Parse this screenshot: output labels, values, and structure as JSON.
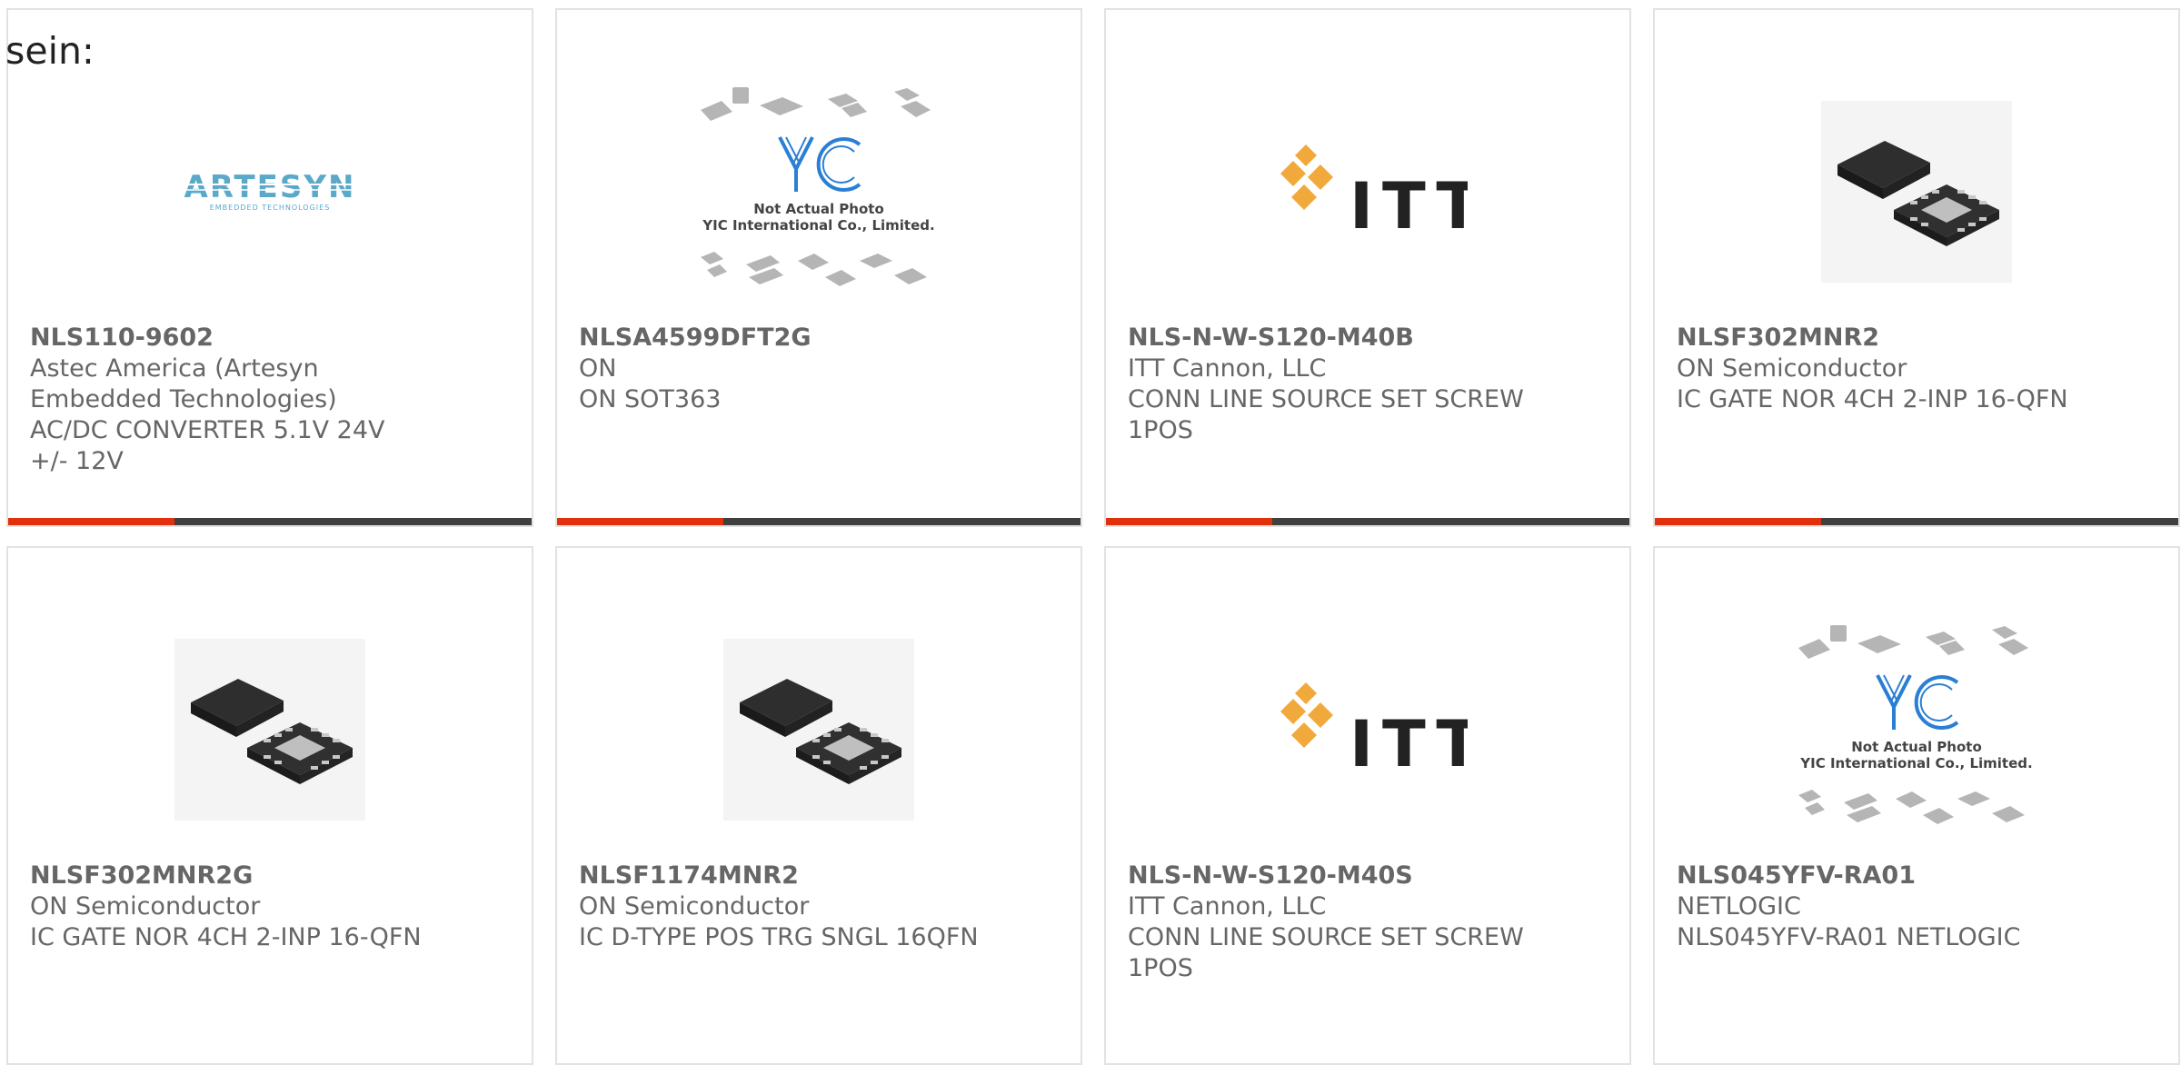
{
  "page": {
    "heading_fragment": "sein:"
  },
  "colors": {
    "accent": "#e0300c",
    "bar": "#404040",
    "text": "#666666",
    "border": "#e2e2e2"
  },
  "products": [
    {
      "part_number": "NLS110-9602",
      "manufacturer": "Astec America (Artesyn Embedded Technologies)",
      "description": "AC/DC CONVERTER 5.1V 24V +/- 12V",
      "image": "artesyn-logo",
      "logo_text": "ARTESYN",
      "logo_subtext": "EMBEDDED TECHNOLOGIES"
    },
    {
      "part_number": "NLSA4599DFT2G",
      "manufacturer": "ON",
      "description": "ON SOT363",
      "image": "yic-placeholder",
      "placeholder_line1": "Not Actual Photo",
      "placeholder_line2": "YIC International Co., Limited."
    },
    {
      "part_number": "NLS-N-W-S120-M40B",
      "manufacturer": "ITT Cannon, LLC",
      "description": "CONN LINE SOURCE SET SCREW 1POS",
      "image": "itt-logo",
      "logo_text": "ITT"
    },
    {
      "part_number": "NLSF302MNR2",
      "manufacturer": "ON Semiconductor",
      "description": "IC GATE NOR 4CH 2-INP 16-QFN",
      "image": "qfn-chip-photo"
    },
    {
      "part_number": "NLSF302MNR2G",
      "manufacturer": "ON Semiconductor",
      "description": "IC GATE NOR 4CH 2-INP 16-QFN",
      "image": "qfn-chip-photo"
    },
    {
      "part_number": "NLSF1174MNR2",
      "manufacturer": "ON Semiconductor",
      "description": "IC D-TYPE POS TRG SNGL 16QFN",
      "image": "qfn-chip-photo"
    },
    {
      "part_number": "NLS-N-W-S120-M40S",
      "manufacturer": "ITT Cannon, LLC",
      "description": "CONN LINE SOURCE SET SCREW 1POS",
      "image": "itt-logo",
      "logo_text": "ITT"
    },
    {
      "part_number": "NLS045YFV-RA01",
      "manufacturer": "NETLOGIC",
      "description": "NLS045YFV-RA01 NETLOGIC",
      "image": "yic-placeholder",
      "placeholder_line1": "Not Actual Photo",
      "placeholder_line2": "YIC International Co., Limited."
    }
  ]
}
